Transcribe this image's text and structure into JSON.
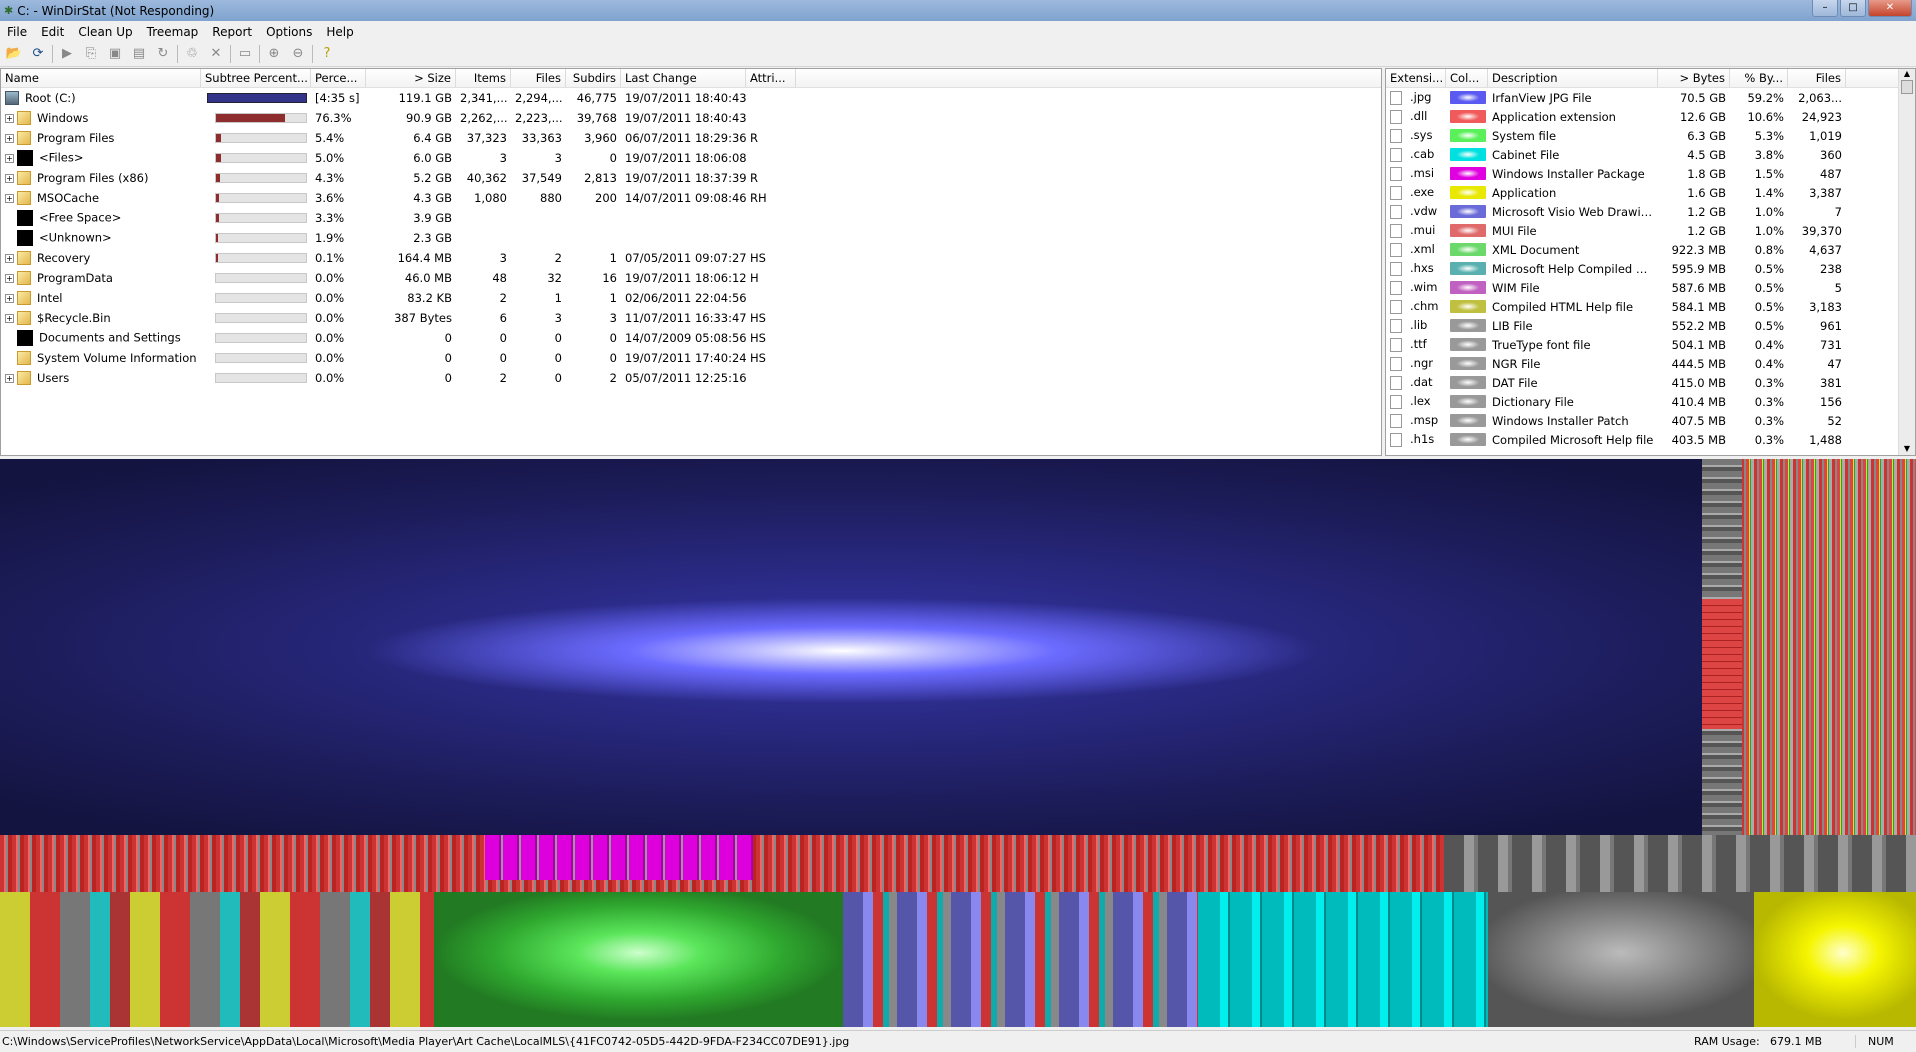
{
  "window": {
    "title": "C: - WinDirStat (Not Responding)"
  },
  "menu": [
    "File",
    "Edit",
    "Clean Up",
    "Treemap",
    "Report",
    "Options",
    "Help"
  ],
  "toolbar": [
    "open-icon",
    "refresh-icon",
    "play-icon",
    "copy-icon",
    "explorer-icon",
    "cmd-icon",
    "refresh-selected-icon",
    "recycle-icon",
    "delete-icon",
    "properties-icon",
    "zoom-in-icon",
    "zoom-out-icon",
    "help-icon"
  ],
  "tree": {
    "columns": [
      "Name",
      "Subtree Percent...",
      "Perce...",
      "> Size",
      "Items",
      "Files",
      "Subdirs",
      "Last Change",
      "Attri..."
    ],
    "rows": [
      {
        "name": "Root (C:)",
        "bar": 100,
        "pct": "[4:35 s]",
        "size": "119.1 GB",
        "items": "2,341,...",
        "files": "2,294,...",
        "subdirs": "46,775",
        "date": "19/07/2011 18:40:43",
        "attr": "",
        "icon": "drive"
      },
      {
        "name": "Windows",
        "bar": 76.3,
        "pct": "76.3%",
        "size": "90.9 GB",
        "items": "2,262,...",
        "files": "2,223,...",
        "subdirs": "39,768",
        "date": "19/07/2011 18:40:43",
        "attr": "",
        "icon": "folder",
        "exp": true
      },
      {
        "name": "Program Files",
        "bar": 5.4,
        "pct": "5.4%",
        "size": "6.4 GB",
        "items": "37,323",
        "files": "33,363",
        "subdirs": "3,960",
        "date": "06/07/2011 18:29:36",
        "attr": "R",
        "icon": "folder",
        "exp": true
      },
      {
        "name": "<Files>",
        "bar": 5.0,
        "pct": "5.0%",
        "size": "6.0 GB",
        "items": "3",
        "files": "3",
        "subdirs": "0",
        "date": "19/07/2011 18:06:08",
        "attr": "",
        "icon": "black",
        "exp": true
      },
      {
        "name": "Program Files (x86)",
        "bar": 4.3,
        "pct": "4.3%",
        "size": "5.2 GB",
        "items": "40,362",
        "files": "37,549",
        "subdirs": "2,813",
        "date": "19/07/2011 18:37:39",
        "attr": "R",
        "icon": "folder",
        "exp": true
      },
      {
        "name": "MSOCache",
        "bar": 3.6,
        "pct": "3.6%",
        "size": "4.3 GB",
        "items": "1,080",
        "files": "880",
        "subdirs": "200",
        "date": "14/07/2011 09:08:46",
        "attr": "RH",
        "icon": "folder",
        "exp": true
      },
      {
        "name": "<Free Space>",
        "bar": 3.3,
        "pct": "3.3%",
        "size": "3.9 GB",
        "items": "",
        "files": "",
        "subdirs": "",
        "date": "",
        "attr": "",
        "icon": "black"
      },
      {
        "name": "<Unknown>",
        "bar": 1.9,
        "pct": "1.9%",
        "size": "2.3 GB",
        "items": "",
        "files": "",
        "subdirs": "",
        "date": "",
        "attr": "",
        "icon": "black"
      },
      {
        "name": "Recovery",
        "bar": 0.1,
        "pct": "0.1%",
        "size": "164.4 MB",
        "items": "3",
        "files": "2",
        "subdirs": "1",
        "date": "07/05/2011 09:07:27",
        "attr": "HS",
        "icon": "folder",
        "exp": true
      },
      {
        "name": "ProgramData",
        "bar": 0,
        "pct": "0.0%",
        "size": "46.0 MB",
        "items": "48",
        "files": "32",
        "subdirs": "16",
        "date": "19/07/2011 18:06:12",
        "attr": "H",
        "icon": "folder",
        "exp": true
      },
      {
        "name": "Intel",
        "bar": 0,
        "pct": "0.0%",
        "size": "83.2 KB",
        "items": "2",
        "files": "1",
        "subdirs": "1",
        "date": "02/06/2011 22:04:56",
        "attr": "",
        "icon": "folder",
        "exp": true
      },
      {
        "name": "$Recycle.Bin",
        "bar": 0,
        "pct": "0.0%",
        "size": "387 Bytes",
        "items": "6",
        "files": "3",
        "subdirs": "3",
        "date": "11/07/2011 16:33:47",
        "attr": "HS",
        "icon": "folder",
        "exp": true
      },
      {
        "name": "Documents and Settings",
        "bar": 0,
        "pct": "0.0%",
        "size": "0",
        "items": "0",
        "files": "0",
        "subdirs": "0",
        "date": "14/07/2009 05:08:56",
        "attr": "HS",
        "icon": "black"
      },
      {
        "name": "System Volume Information",
        "bar": 0,
        "pct": "0.0%",
        "size": "0",
        "items": "0",
        "files": "0",
        "subdirs": "0",
        "date": "19/07/2011 17:40:24",
        "attr": "HS",
        "icon": "folder"
      },
      {
        "name": "Users",
        "bar": 0,
        "pct": "0.0%",
        "size": "0",
        "items": "2",
        "files": "0",
        "subdirs": "2",
        "date": "05/07/2011 12:25:16",
        "attr": "",
        "icon": "folder",
        "exp": true
      }
    ]
  },
  "extensions": {
    "columns": [
      "Extensi...",
      "Col...",
      "Description",
      "> Bytes",
      "% By...",
      "Files"
    ],
    "rows": [
      {
        "ext": ".jpg",
        "color": "#5a5af0",
        "desc": "IrfanView JPG File",
        "bytes": "70.5 GB",
        "pct": "59.2%",
        "files": "2,063..."
      },
      {
        "ext": ".dll",
        "color": "#f05a5a",
        "desc": "Application extension",
        "bytes": "12.6 GB",
        "pct": "10.6%",
        "files": "24,923"
      },
      {
        "ext": ".sys",
        "color": "#5af05a",
        "desc": "System file",
        "bytes": "6.3 GB",
        "pct": "5.3%",
        "files": "1,019"
      },
      {
        "ext": ".cab",
        "color": "#00e0e0",
        "desc": "Cabinet File",
        "bytes": "4.5 GB",
        "pct": "3.8%",
        "files": "360"
      },
      {
        "ext": ".msi",
        "color": "#e000e0",
        "desc": "Windows Installer Package",
        "bytes": "1.8 GB",
        "pct": "1.5%",
        "files": "487"
      },
      {
        "ext": ".exe",
        "color": "#e8e800",
        "desc": "Application",
        "bytes": "1.6 GB",
        "pct": "1.4%",
        "files": "3,387"
      },
      {
        "ext": ".vdw",
        "color": "#6a6ad8",
        "desc": "Microsoft Visio Web Drawing",
        "bytes": "1.2 GB",
        "pct": "1.0%",
        "files": "7"
      },
      {
        "ext": ".mui",
        "color": "#e06a6a",
        "desc": "MUI File",
        "bytes": "1.2 GB",
        "pct": "1.0%",
        "files": "39,370"
      },
      {
        "ext": ".xml",
        "color": "#6ad86a",
        "desc": "XML Document",
        "bytes": "922.3 MB",
        "pct": "0.8%",
        "files": "4,637"
      },
      {
        "ext": ".hxs",
        "color": "#5ab0b0",
        "desc": "Microsoft Help Compiled St...",
        "bytes": "595.9 MB",
        "pct": "0.5%",
        "files": "238"
      },
      {
        "ext": ".wim",
        "color": "#c060c0",
        "desc": "WIM File",
        "bytes": "587.6 MB",
        "pct": "0.5%",
        "files": "5"
      },
      {
        "ext": ".chm",
        "color": "#c0c040",
        "desc": "Compiled HTML Help file",
        "bytes": "584.1 MB",
        "pct": "0.5%",
        "files": "3,183"
      },
      {
        "ext": ".lib",
        "color": "#999999",
        "desc": "LIB File",
        "bytes": "552.2 MB",
        "pct": "0.5%",
        "files": "961"
      },
      {
        "ext": ".ttf",
        "color": "#999999",
        "desc": "TrueType font file",
        "bytes": "504.1 MB",
        "pct": "0.4%",
        "files": "731"
      },
      {
        "ext": ".ngr",
        "color": "#999999",
        "desc": "NGR File",
        "bytes": "444.5 MB",
        "pct": "0.4%",
        "files": "47"
      },
      {
        "ext": ".dat",
        "color": "#999999",
        "desc": "DAT File",
        "bytes": "415.0 MB",
        "pct": "0.3%",
        "files": "381"
      },
      {
        "ext": ".lex",
        "color": "#999999",
        "desc": "Dictionary File",
        "bytes": "410.4 MB",
        "pct": "0.3%",
        "files": "156"
      },
      {
        "ext": ".msp",
        "color": "#999999",
        "desc": "Windows Installer Patch",
        "bytes": "407.5 MB",
        "pct": "0.3%",
        "files": "52"
      },
      {
        "ext": ".h1s",
        "color": "#999999",
        "desc": "Compiled Microsoft Help file",
        "bytes": "403.5 MB",
        "pct": "0.3%",
        "files": "1,488"
      }
    ]
  },
  "status": {
    "path": "C:\\Windows\\ServiceProfiles\\NetworkService\\AppData\\Local\\Microsoft\\Media Player\\Art Cache\\LocalMLS\\{41FC0742-05D5-442D-9FDA-F234CC07DE91}.jpg",
    "ram_label": "RAM Usage:",
    "ram_value": "679.1 MB",
    "num": "NUM"
  }
}
